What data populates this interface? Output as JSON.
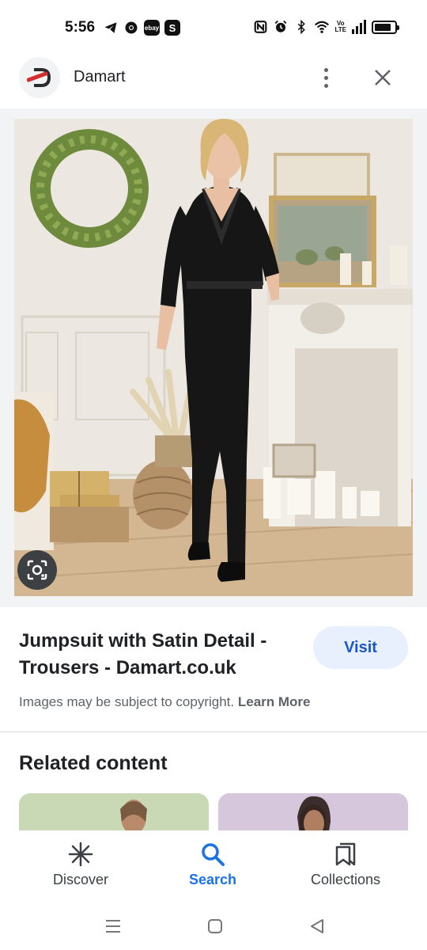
{
  "status_bar": {
    "time": "5:56",
    "left_icons": [
      "telegram-icon",
      "chrome-icon",
      "ebay-icon",
      "s-app-icon"
    ],
    "ebay_text": "ebay",
    "s_text": "S",
    "lte_top": "Vo",
    "lte_bottom": "LTE",
    "right_icons": [
      "nfc-icon",
      "alarm-icon",
      "bluetooth-icon",
      "wifi-icon",
      "volte-icon",
      "signal-icon",
      "battery-icon"
    ],
    "battery_level": 0.85
  },
  "header": {
    "site_name": "Damart",
    "logo_icon": "damart-logo-icon",
    "brand_color": "#d32f2f"
  },
  "result": {
    "title": "Jumpsuit with Satin Detail - Trousers - Damart.co.uk",
    "visit_label": "Visit",
    "copyright_text": "Images may be subject to copyright.",
    "learn_more": "Learn More"
  },
  "related": {
    "heading": "Related content"
  },
  "bottom_nav": {
    "items": [
      {
        "label": "Discover",
        "icon": "asterisk-icon"
      },
      {
        "label": "Search",
        "icon": "search-icon"
      },
      {
        "label": "Collections",
        "icon": "bookmark-icon"
      }
    ],
    "active_color": "#1a73e8"
  },
  "system_nav": {
    "icons": [
      "menu-icon",
      "home-icon",
      "back-icon"
    ]
  }
}
